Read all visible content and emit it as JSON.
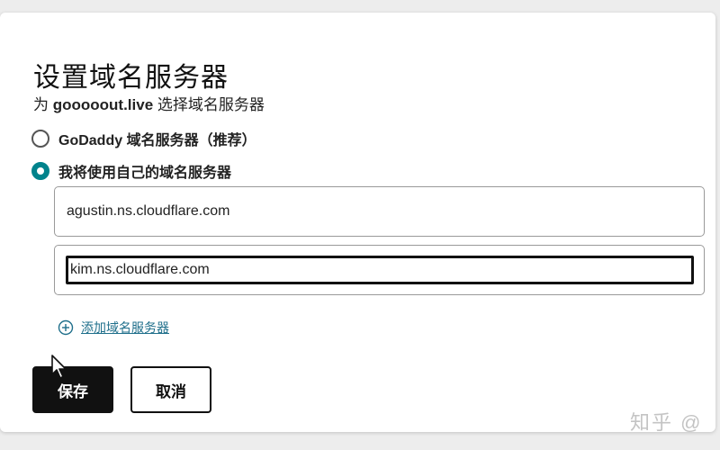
{
  "dialog": {
    "title": "设置域名服务器",
    "subtitle_prefix": "为 ",
    "subtitle_domain": "gooooout.live",
    "subtitle_suffix": " 选择域名服务器"
  },
  "options": [
    {
      "label": "GoDaddy 域名服务器（推荐）",
      "checked": false
    },
    {
      "label": "我将使用自己的域名服务器",
      "checked": true
    }
  ],
  "nameservers": [
    {
      "value": "agustin.ns.cloudflare.com"
    },
    {
      "value": "kim.ns.cloudflare.com"
    }
  ],
  "add_link": {
    "label": "添加域名服务器",
    "icon": "plus-circle-icon"
  },
  "buttons": {
    "save_label": "保存",
    "cancel_label": "取消"
  },
  "watermark": {
    "text": "知乎 @"
  },
  "colors": {
    "accent": "#00838c",
    "link": "#1f6f8b",
    "primary_button": "#111111"
  }
}
